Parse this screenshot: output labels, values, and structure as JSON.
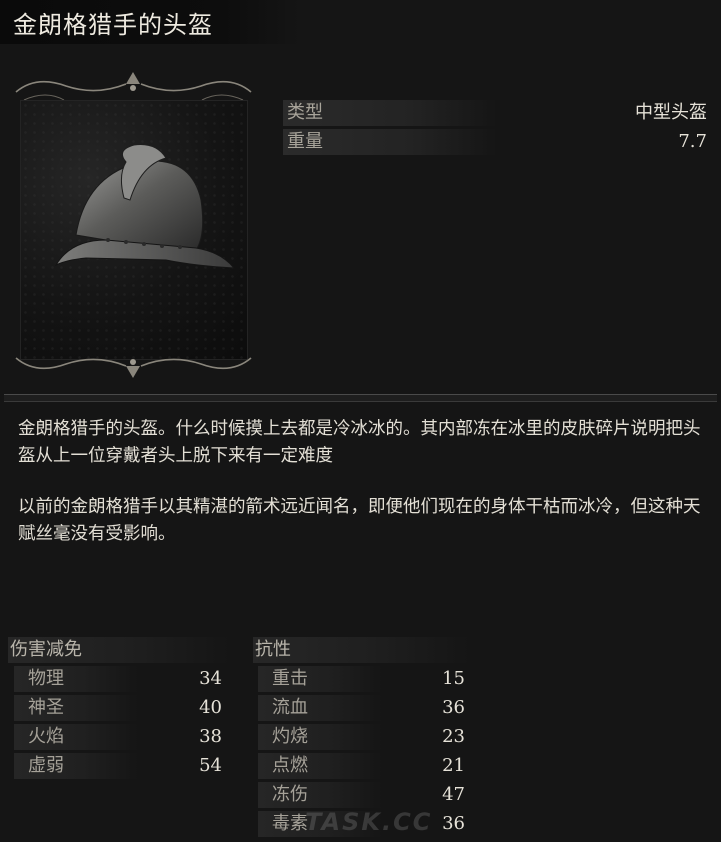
{
  "item": {
    "name": "金朗格猎手的头盔"
  },
  "stats": {
    "type_label": "类型",
    "type_value": "中型头盔",
    "weight_label": "重量",
    "weight_value": "7.7"
  },
  "description": {
    "p1": "金朗格猎手的头盔。什么时候摸上去都是冷冰冰的。其内部冻在冰里的皮肤碎片说明把头盔从上一位穿戴者头上脱下来有一定难度",
    "p2": "以前的金朗格猎手以其精湛的箭术远近闻名，即便他们现在的身体干枯而冰冷，但这种天赋丝毫没有受影响。"
  },
  "damage_negation": {
    "header": "伤害减免",
    "rows": [
      {
        "name": "物理",
        "value": "34"
      },
      {
        "name": "神圣",
        "value": "40"
      },
      {
        "name": "火焰",
        "value": "38"
      },
      {
        "name": "虚弱",
        "value": "54"
      }
    ]
  },
  "resistance": {
    "header": "抗性",
    "rows": [
      {
        "name": "重击",
        "value": "15"
      },
      {
        "name": "流血",
        "value": "36"
      },
      {
        "name": "灼烧",
        "value": "23"
      },
      {
        "name": "点燃",
        "value": "21"
      },
      {
        "name": "冻伤",
        "value": "47"
      },
      {
        "name": "毒素",
        "value": "36"
      }
    ]
  },
  "watermark": "TASK.CC",
  "colors": {
    "background": "#151515",
    "text": "#d6d2c8"
  }
}
